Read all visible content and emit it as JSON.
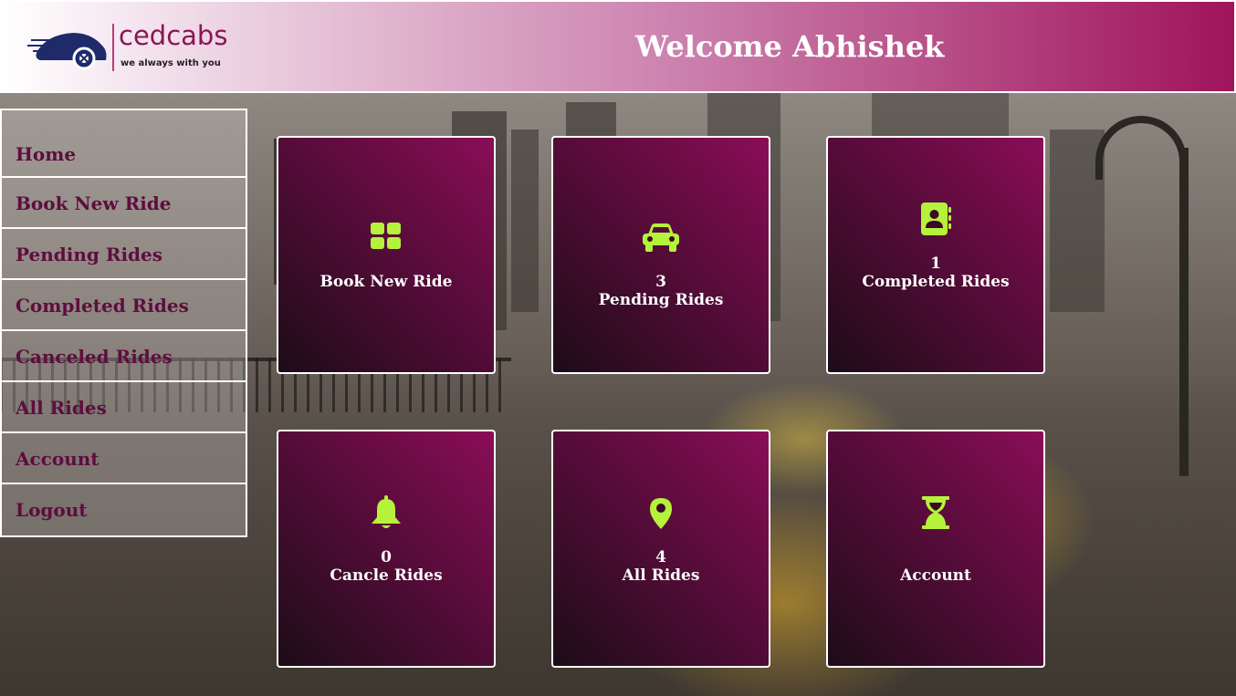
{
  "header": {
    "logo_name": "cedcabs",
    "logo_tagline": "we always with you",
    "welcome": "Welcome Abhishek"
  },
  "sidebar": {
    "items": [
      {
        "label": "Home"
      },
      {
        "label": "Book New Ride"
      },
      {
        "label": "Pending Rides"
      },
      {
        "label": "Completed Rides"
      },
      {
        "label": "Canceled Rides"
      },
      {
        "label": "All Rides"
      },
      {
        "label": "Account"
      },
      {
        "label": "Logout"
      }
    ]
  },
  "cards": [
    {
      "icon": "grid-icon",
      "count": "",
      "label": "Book New Ride"
    },
    {
      "icon": "car-icon",
      "count": "3",
      "label": "Pending Rides"
    },
    {
      "icon": "address-book-icon",
      "count": "1",
      "label": "Completed Rides"
    },
    {
      "icon": "bell-icon",
      "count": "0",
      "label": "Cancle Rides"
    },
    {
      "icon": "map-pin-icon",
      "count": "4",
      "label": "All Rides"
    },
    {
      "icon": "hourglass-icon",
      "count": "",
      "label": "Account"
    }
  ],
  "colors": {
    "brand": "#8a0d57",
    "icon_accent": "#b5f23a",
    "sidebar_text": "#5e0d3e"
  }
}
